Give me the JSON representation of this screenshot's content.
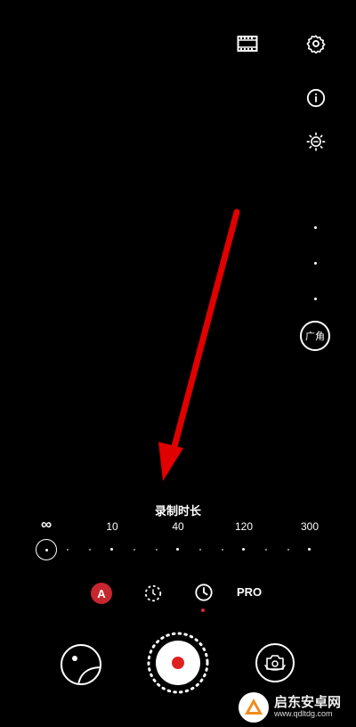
{
  "top_icons": {
    "film": "film-icon",
    "settings": "gear-icon",
    "info": "info-icon",
    "exposure": "exposure-icon"
  },
  "zoom": {
    "lens_label": "广角"
  },
  "duration": {
    "title": "录制时长",
    "ticks": [
      "∞",
      "10",
      "40",
      "120",
      "300"
    ],
    "selected": "∞"
  },
  "modes": {
    "auto_label": "A",
    "pro_label": "PRO",
    "selected": "timer-mode",
    "accent": "#e02a2a"
  },
  "controls": {
    "shutter_color": "#e02020"
  },
  "watermark": {
    "title": "启东安卓网",
    "url": "www.qdltdg.com"
  }
}
